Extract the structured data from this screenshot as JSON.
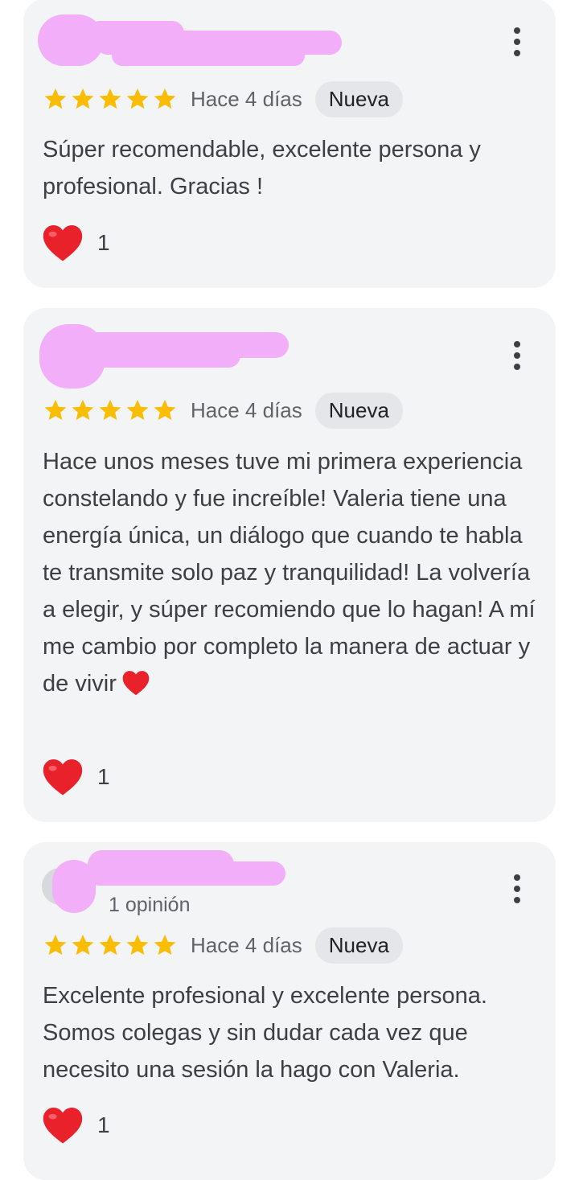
{
  "reviews": [
    {
      "rating": 5,
      "date": "Hace 4 días",
      "badge": "Nueva",
      "text": "Súper recomendable, excelente persona y profesional. Gracias !",
      "reaction_count": "1"
    },
    {
      "rating": 5,
      "date": "Hace 4 días",
      "badge": "Nueva",
      "text": "Hace unos meses tuve mi primera experiencia constelando y fue increíble! Valeria tiene una energía única, un diálogo que cuando te habla te transmite solo paz y tranquilidad! La volvería a elegir, y súper recomiendo que lo hagan! A mí me cambio por completo la manera de actuar y de vivir",
      "reaction_count": "1"
    },
    {
      "rating": 5,
      "author_meta": "1 opinión",
      "date": "Hace 4 días",
      "badge": "Nueva",
      "text": "Excelente profesional y excelente persona. Somos colegas y sin dudar cada vez que necesito una sesión la hago con Valeria.",
      "reaction_count": "1"
    }
  ],
  "icons": {
    "star": "star-icon",
    "more": "more-vert-icon",
    "reaction": "heart-icon"
  },
  "colors": {
    "card_background": "#f3f4f6",
    "star": "#fbbc04",
    "heart": "#e8212b",
    "badge_background": "#e4e6e9",
    "redaction": "#f2aef8"
  }
}
